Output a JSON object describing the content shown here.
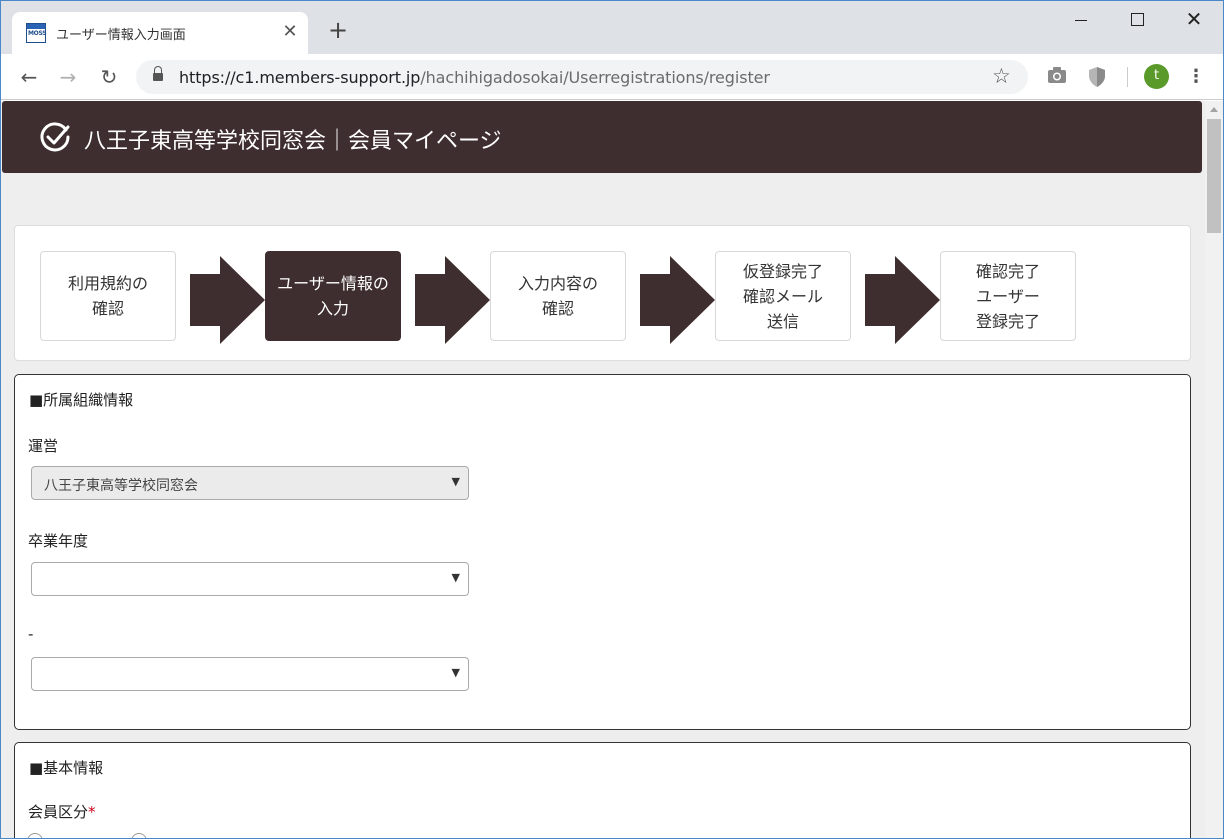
{
  "browser": {
    "tab_title": "ユーザー情報入力画面",
    "favicon_text": "MOSS",
    "new_tab": "+",
    "close": "✕",
    "url_host": "https://c1.members-support.jp",
    "url_path": "/hachihigadosokai/Userregistrations/register",
    "avatar_letter": "t"
  },
  "header": {
    "title": "八王子東高等学校同窓会｜会員マイページ"
  },
  "steps": [
    {
      "label": "利用規約の\n確認",
      "active": false
    },
    {
      "label": "ユーザー情報の\n入力",
      "active": true
    },
    {
      "label": "入力内容の\n確認",
      "active": false
    },
    {
      "label": "仮登録完了\n確認メール\n送信",
      "active": false
    },
    {
      "label": "確認完了\nユーザー\n登録完了",
      "active": false
    }
  ],
  "affiliation": {
    "section_title": "■所属組織情報",
    "org_label": "運営",
    "org_value": "八王子東高等学校同窓会",
    "grad_year_label": "卒業年度",
    "grad_year_value": "",
    "sub_label": "-",
    "sub_value": ""
  },
  "basic": {
    "section_title": "■基本情報",
    "member_type_label": "会員区分",
    "required_mark": "*"
  },
  "colors": {
    "brand": "#3f2e2f",
    "required": "#d0021b"
  }
}
